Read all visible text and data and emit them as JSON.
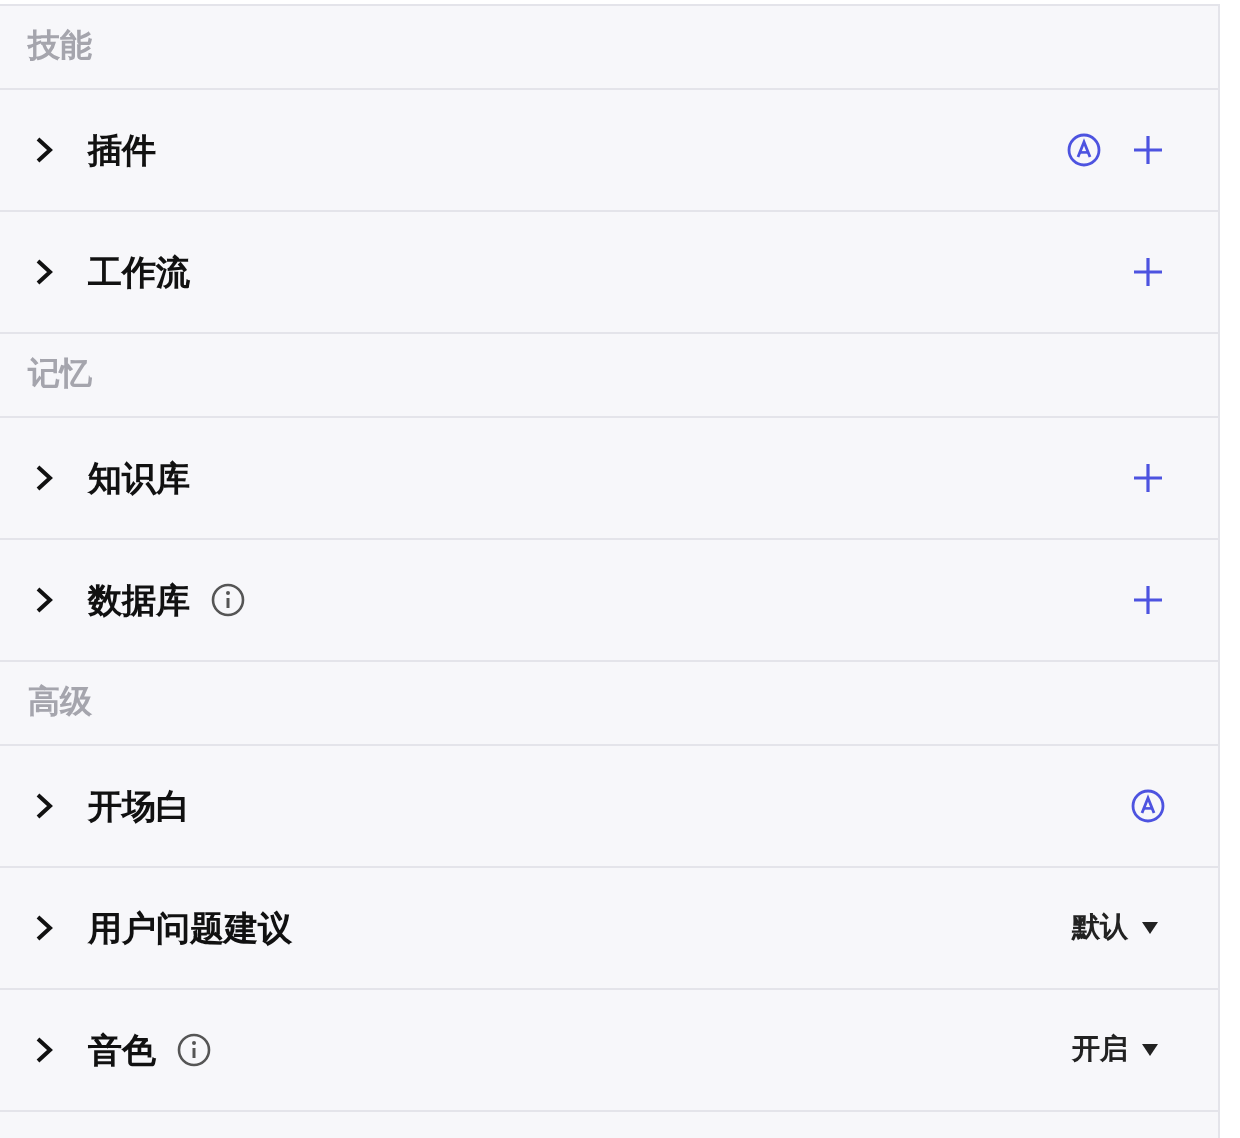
{
  "sections": [
    {
      "title": "技能",
      "items": [
        {
          "label": "插件",
          "info": false,
          "actions": [
            {
              "kind": "auto"
            },
            {
              "kind": "add"
            }
          ]
        },
        {
          "label": "工作流",
          "info": false,
          "actions": [
            {
              "kind": "add"
            }
          ]
        }
      ]
    },
    {
      "title": "记忆",
      "items": [
        {
          "label": "知识库",
          "info": false,
          "actions": [
            {
              "kind": "add"
            }
          ]
        },
        {
          "label": "数据库",
          "info": true,
          "actions": [
            {
              "kind": "add"
            }
          ]
        }
      ]
    },
    {
      "title": "高级",
      "items": [
        {
          "label": "开场白",
          "info": false,
          "actions": [
            {
              "kind": "auto"
            }
          ]
        },
        {
          "label": "用户问题建议",
          "info": false,
          "actions": [
            {
              "kind": "dropdown",
              "value": "默认"
            }
          ]
        },
        {
          "label": "音色",
          "info": true,
          "actions": [
            {
              "kind": "dropdown",
              "value": "开启"
            }
          ]
        }
      ]
    }
  ]
}
